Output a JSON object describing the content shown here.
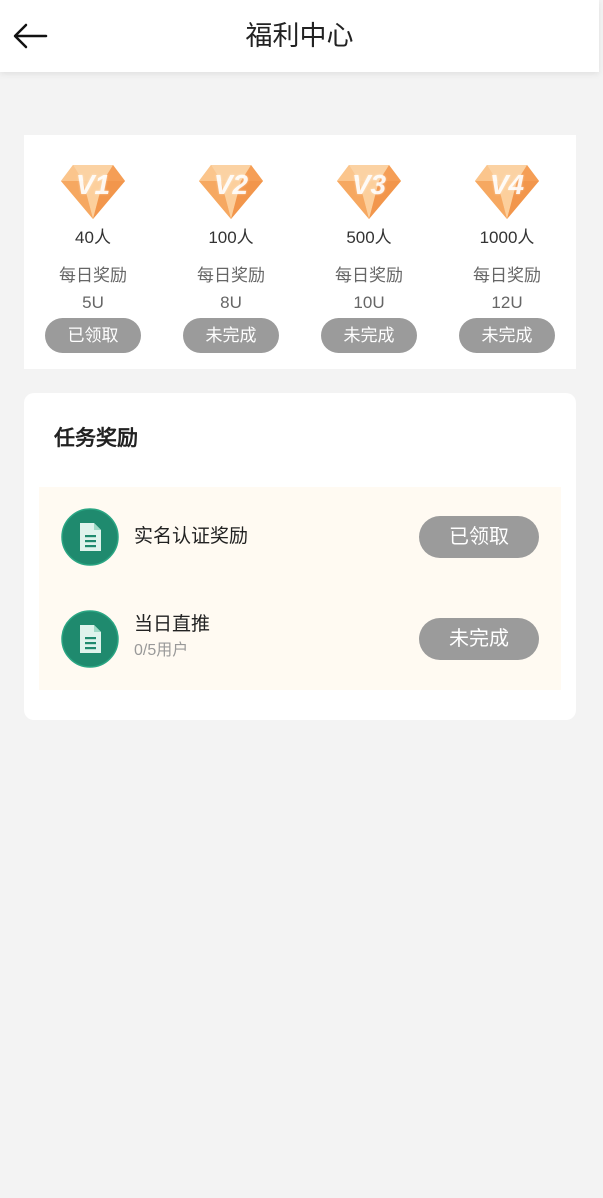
{
  "header": {
    "back_icon": "arrow-left-icon",
    "title": "福利中心"
  },
  "levels": [
    {
      "label": "V1",
      "people": "40人",
      "reward_label": "每日奖励",
      "reward": "5U",
      "button": "已领取"
    },
    {
      "label": "V2",
      "people": "100人",
      "reward_label": "每日奖励",
      "reward": "8U",
      "button": "未完成"
    },
    {
      "label": "V3",
      "people": "500人",
      "reward_label": "每日奖励",
      "reward": "10U",
      "button": "未完成"
    },
    {
      "label": "V4",
      "people": "1000人",
      "reward_label": "每日奖励",
      "reward": "12U",
      "button": "未完成"
    }
  ],
  "tasks": {
    "title": "任务奖励",
    "items": [
      {
        "name": "实名认证奖励",
        "sub": "",
        "button": "已领取",
        "icon": "document-icon"
      },
      {
        "name": "当日直推",
        "sub": "0/5用户",
        "button": "未完成",
        "icon": "document-icon"
      }
    ]
  },
  "colors": {
    "background": "#f3f3f3",
    "button_gray": "#9b9b9b",
    "diamond_orange": "#f7a35c",
    "task_icon_green": "#1f8a6e",
    "task_list_bg": "#fffaf2"
  }
}
